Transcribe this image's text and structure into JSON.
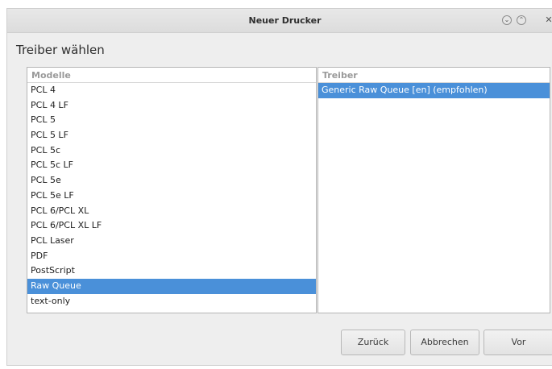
{
  "window": {
    "title": "Neuer Drucker",
    "controls": {
      "minimize": "⌄",
      "maximize": "⌃",
      "close": "✕"
    }
  },
  "heading": "Treiber wählen",
  "models": {
    "header": "Modelle",
    "items": [
      {
        "label": "PCL 4",
        "selected": false
      },
      {
        "label": "PCL 4 LF",
        "selected": false
      },
      {
        "label": "PCL 5",
        "selected": false
      },
      {
        "label": "PCL 5 LF",
        "selected": false
      },
      {
        "label": "PCL 5c",
        "selected": false
      },
      {
        "label": "PCL 5c LF",
        "selected": false
      },
      {
        "label": "PCL 5e",
        "selected": false
      },
      {
        "label": "PCL 5e LF",
        "selected": false
      },
      {
        "label": "PCL 6/PCL XL",
        "selected": false
      },
      {
        "label": "PCL 6/PCL XL LF",
        "selected": false
      },
      {
        "label": "PCL Laser",
        "selected": false
      },
      {
        "label": "PDF",
        "selected": false
      },
      {
        "label": "PostScript",
        "selected": false
      },
      {
        "label": "Raw Queue",
        "selected": true
      },
      {
        "label": "text-only",
        "selected": false
      }
    ]
  },
  "drivers": {
    "header": "Treiber",
    "items": [
      {
        "label": "Generic Raw Queue [en] (empfohlen)",
        "selected": true
      }
    ]
  },
  "buttons": {
    "back": "Zurück",
    "cancel": "Abbrechen",
    "next": "Vor"
  },
  "colors": {
    "selection": "#4a90d9",
    "window_bg": "#eeeeee"
  }
}
